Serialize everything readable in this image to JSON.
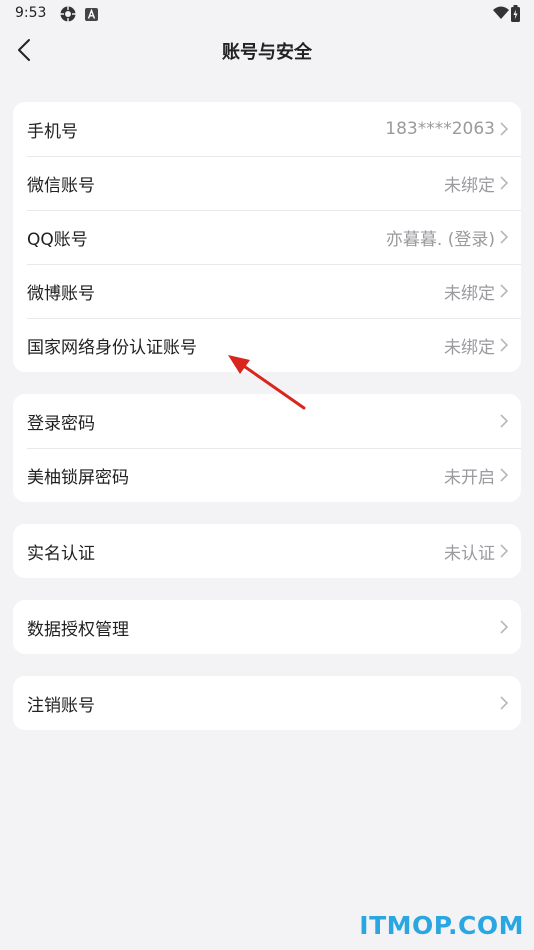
{
  "status_bar": {
    "time": "9:53",
    "icons": [
      "gear-icon",
      "a-badge-icon",
      "wifi-icon",
      "battery-icon"
    ]
  },
  "nav": {
    "title": "账号与安全",
    "back_icon": "chevron-left-icon"
  },
  "groups": [
    {
      "rows": [
        {
          "label": "手机号",
          "value": "183****2063"
        },
        {
          "label": "微信账号",
          "value": "未绑定"
        },
        {
          "label": "QQ账号",
          "value": "亦暮暮. (登录)"
        },
        {
          "label": "微博账号",
          "value": "未绑定"
        },
        {
          "label": "国家网络身份认证账号",
          "value": "未绑定"
        }
      ]
    },
    {
      "rows": [
        {
          "label": "登录密码",
          "value": ""
        },
        {
          "label": "美柚锁屏密码",
          "value": "未开启"
        }
      ]
    },
    {
      "rows": [
        {
          "label": "实名认证",
          "value": "未认证"
        }
      ]
    },
    {
      "rows": [
        {
          "label": "数据授权管理",
          "value": ""
        }
      ]
    },
    {
      "rows": [
        {
          "label": "注销账号",
          "value": ""
        }
      ]
    }
  ],
  "annotation": {
    "icon": "red-arrow-icon",
    "color": "#d9251c"
  },
  "watermark": "ITMOP.COM",
  "colors": {
    "background": "#f3f3f5",
    "card": "#ffffff",
    "secondary_text": "#9a9a9f",
    "watermark": "#2aa6e0"
  }
}
